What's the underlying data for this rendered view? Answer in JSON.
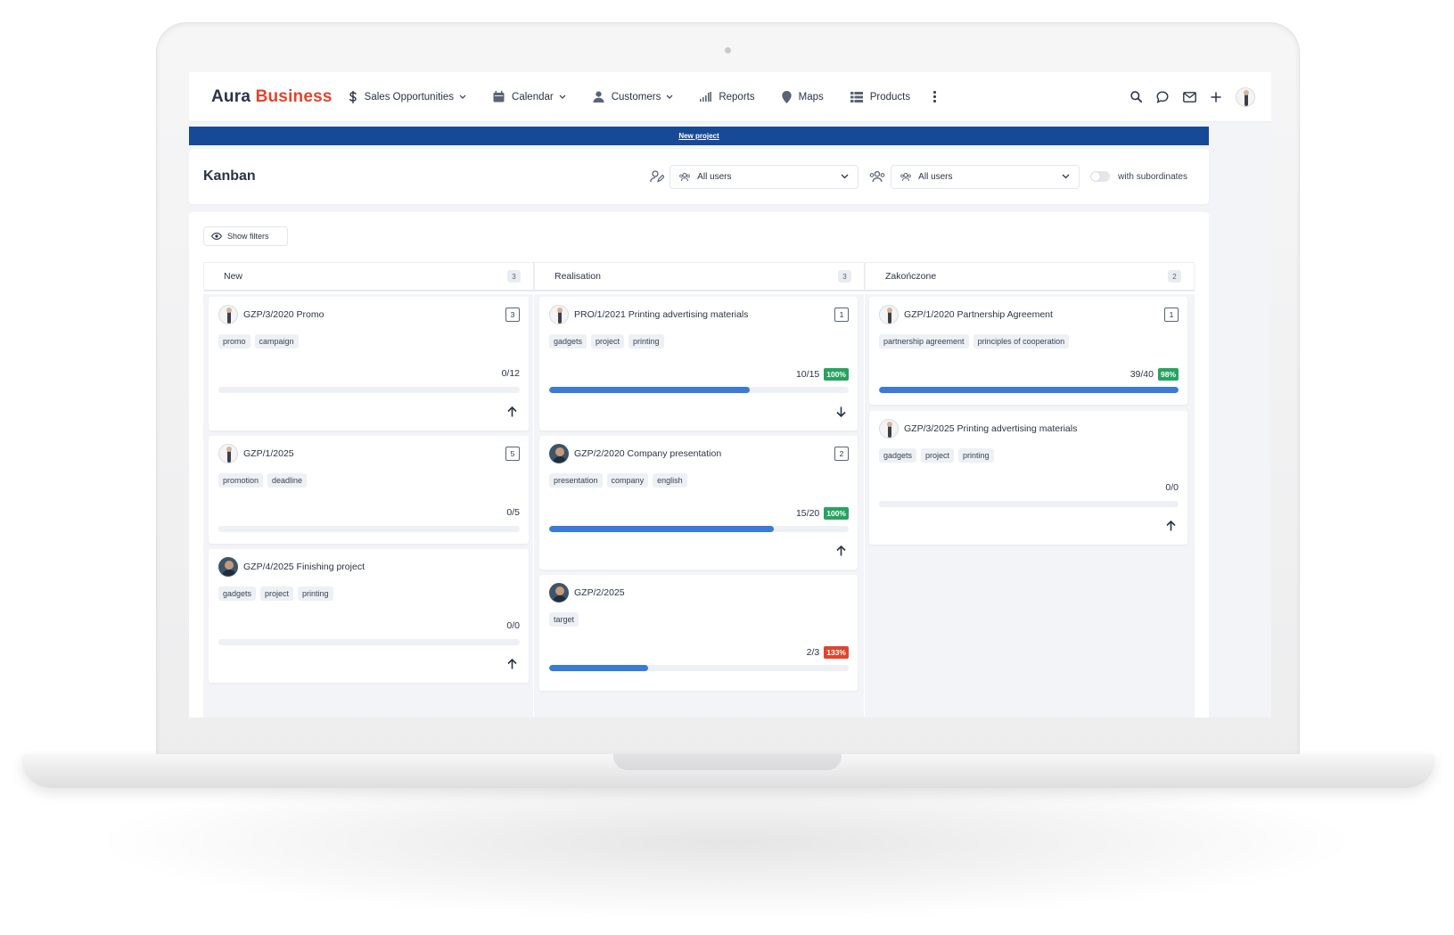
{
  "app": {
    "logo_part1": "Aura",
    "logo_part2": "Business"
  },
  "nav": {
    "items": [
      {
        "label": "Sales Opportunities",
        "icon": "dollar-icon",
        "has_dropdown": true
      },
      {
        "label": "Calendar",
        "icon": "calendar-icon",
        "has_dropdown": true
      },
      {
        "label": "Customers",
        "icon": "user-icon",
        "has_dropdown": true
      },
      {
        "label": "Reports",
        "icon": "bar-chart-icon",
        "has_dropdown": false
      },
      {
        "label": "Maps",
        "icon": "map-pin-icon",
        "has_dropdown": false
      },
      {
        "label": "Products",
        "icon": "grid-list-icon",
        "has_dropdown": false
      }
    ]
  },
  "banner": {
    "link_label": "New project",
    "color": "#174a96"
  },
  "header": {
    "title": "Kanban",
    "filter1_value": "All users",
    "filter2_value": "All users",
    "toggle_label": "with subordinates",
    "toggle_on": false
  },
  "board": {
    "show_filters_label": "Show filters",
    "columns": [
      {
        "title": "New",
        "count": "3",
        "cards": [
          {
            "title": "GZP/3/2020 Promo",
            "avatar": "man",
            "badge": "3",
            "tags": [
              "promo",
              "campaign"
            ],
            "progress": "0/12",
            "pct": "",
            "fill": 0,
            "arrow": "up"
          },
          {
            "title": "GZP/1/2025",
            "avatar": "man",
            "badge": "5",
            "tags": [
              "promotion",
              "deadline"
            ],
            "progress": "0/5",
            "pct": "",
            "fill": 0,
            "arrow": ""
          },
          {
            "title": "GZP/4/2025 Finishing project",
            "avatar": "dark",
            "badge": "",
            "tags": [
              "gadgets",
              "project",
              "printing"
            ],
            "progress": "0/0",
            "pct": "",
            "fill": 0,
            "arrow": "up"
          }
        ]
      },
      {
        "title": "Realisation",
        "count": "3",
        "cards": [
          {
            "title": "PRO/1/2021 Printing advertising materials",
            "avatar": "man",
            "badge": "1",
            "tags": [
              "gadgets",
              "project",
              "printing"
            ],
            "progress": "10/15",
            "pct": "100%",
            "pct_color": "green",
            "fill": 0.67,
            "arrow": "down"
          },
          {
            "title": "GZP/2/2020 Company presentation",
            "avatar": "dark",
            "badge": "2",
            "tags": [
              "presentation",
              "company",
              "english"
            ],
            "progress": "15/20",
            "pct": "100%",
            "pct_color": "green",
            "fill": 0.75,
            "arrow": "up"
          },
          {
            "title": "GZP/2/2025",
            "avatar": "dark",
            "badge": "",
            "tags": [
              "target"
            ],
            "progress": "2/3",
            "pct": "133%",
            "pct_color": "red",
            "fill": 0.33,
            "arrow": ""
          }
        ]
      },
      {
        "title": "Zakończone",
        "count": "2",
        "cards": [
          {
            "title": "GZP/1/2020 Partnership Agreement",
            "avatar": "man",
            "badge": "1",
            "tags": [
              "partnership agreement",
              "principles of cooperation"
            ],
            "progress": "39/40",
            "pct": "98%",
            "pct_color": "green",
            "fill": 1.0,
            "arrow": ""
          },
          {
            "title": "GZP/3/2025 Printing advertising materials",
            "avatar": "man",
            "badge": "",
            "tags": [
              "gadgets",
              "project",
              "printing"
            ],
            "progress": "0/0",
            "pct": "",
            "fill": 0,
            "arrow": "up"
          }
        ]
      }
    ]
  }
}
